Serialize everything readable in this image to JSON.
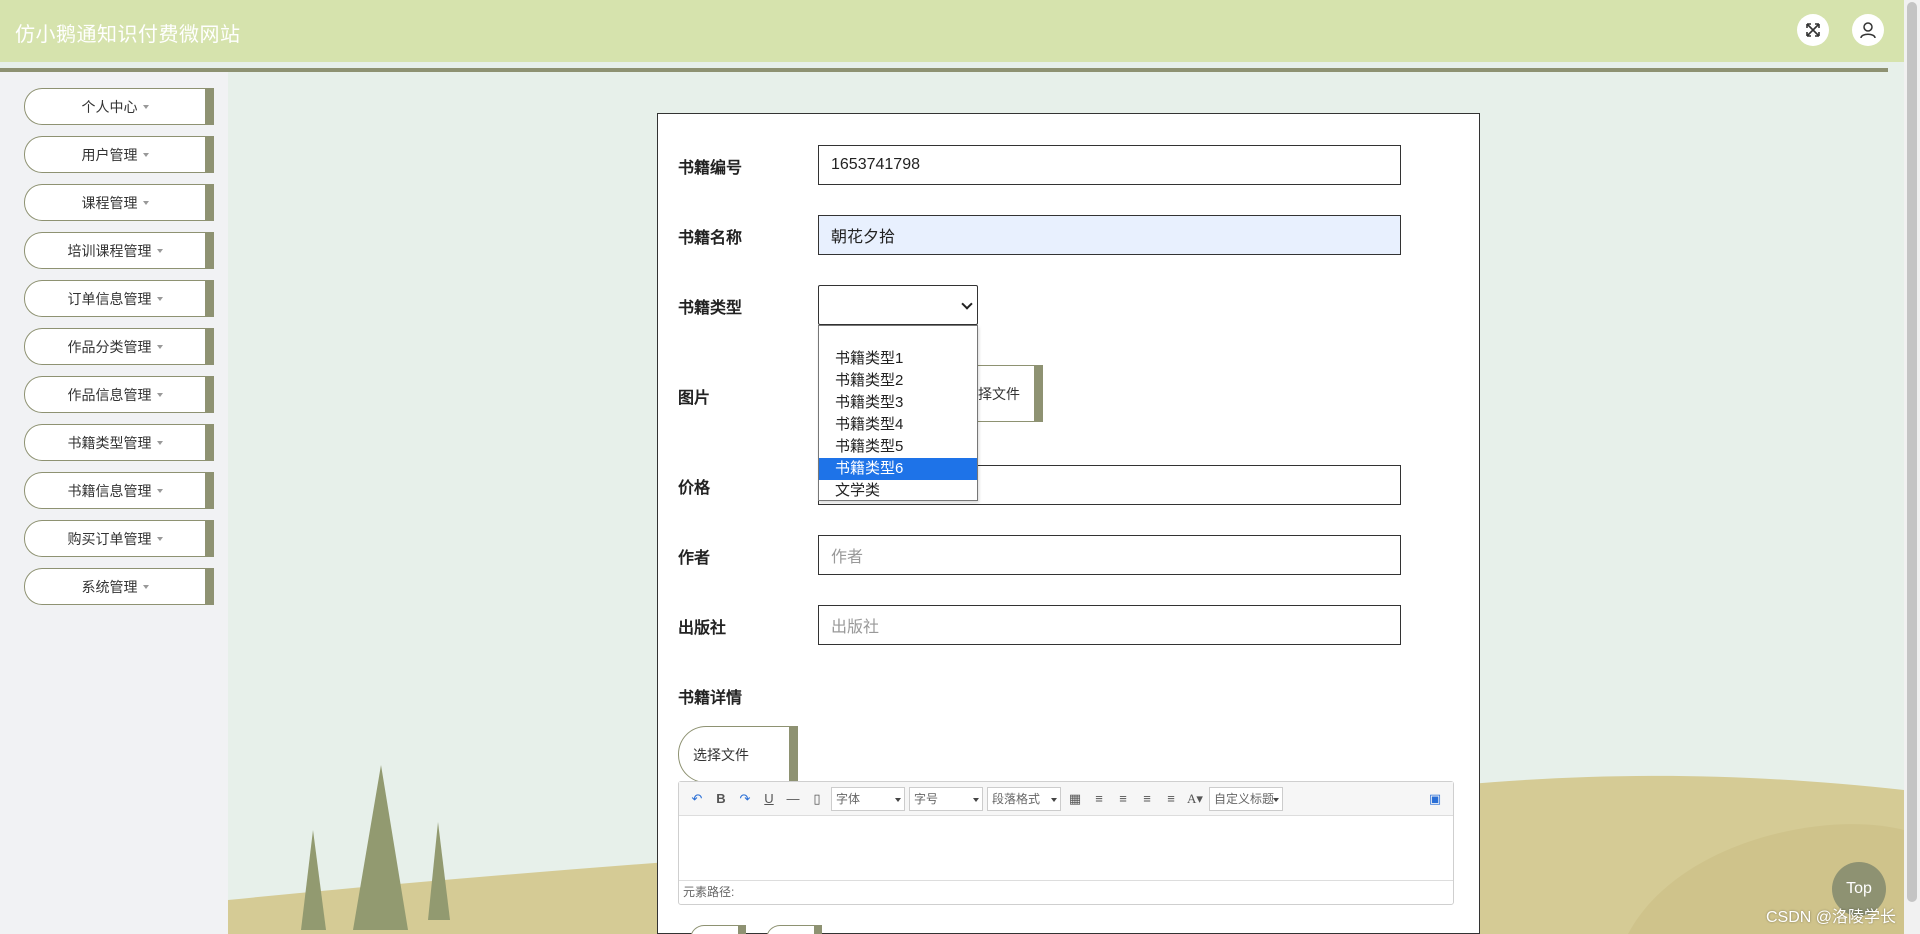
{
  "header": {
    "title": "仿小鹅通知识付费微网站",
    "fullscreen_icon": "expand-icon",
    "user_icon": "user-icon"
  },
  "sidebar": {
    "items": [
      {
        "label": "个人中心"
      },
      {
        "label": "用户管理"
      },
      {
        "label": "课程管理"
      },
      {
        "label": "培训课程管理"
      },
      {
        "label": "订单信息管理"
      },
      {
        "label": "作品分类管理"
      },
      {
        "label": "作品信息管理"
      },
      {
        "label": "书籍类型管理"
      },
      {
        "label": "书籍信息管理"
      },
      {
        "label": "购买订单管理"
      },
      {
        "label": "系统管理"
      }
    ]
  },
  "form": {
    "book_number": {
      "label": "书籍编号",
      "value": "1653741798"
    },
    "book_name": {
      "label": "书籍名称",
      "value": "朝花夕拾"
    },
    "book_type": {
      "label": "书籍类型",
      "value": "",
      "options": [
        "书籍类型1",
        "书籍类型2",
        "书籍类型3",
        "书籍类型4",
        "书籍类型5",
        "书籍类型6",
        "文学类"
      ],
      "highlighted": "书籍类型6"
    },
    "image": {
      "label": "图片",
      "button_label": "选择文件"
    },
    "price": {
      "label": "价格",
      "value": ""
    },
    "author": {
      "label": "作者",
      "placeholder": "作者"
    },
    "publisher": {
      "label": "出版社",
      "placeholder": "出版社"
    },
    "details": {
      "label": "书籍详情",
      "button_label": "选择文件"
    }
  },
  "editor": {
    "font_combo": "字体",
    "size_combo": "字号",
    "para_combo": "段落格式",
    "custom_combo": "自定义标题",
    "path_label": "元素路径:"
  },
  "top_button": "Top",
  "watermark": "CSDN @洛陵学长",
  "colors": {
    "header_bg": "#d6e3ad",
    "accent": "#8e9272",
    "page_bg": "#e7f0ea",
    "selected_option": "#1e73e8"
  }
}
